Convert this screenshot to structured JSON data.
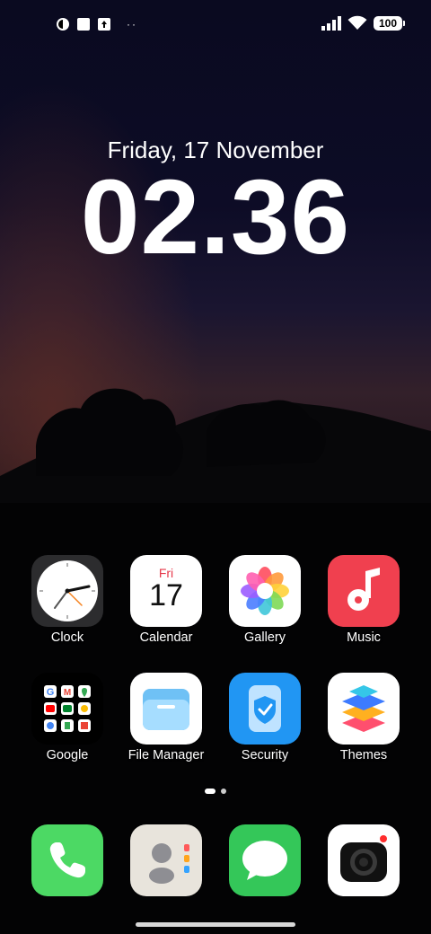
{
  "status_bar": {
    "left_icons": [
      "app-notification-icon",
      "square-notification-icon",
      "upload-notification-icon"
    ],
    "more_dots": "··",
    "right_icons": [
      "signal-icon",
      "wifi-icon"
    ],
    "battery_level": "100"
  },
  "clock_widget": {
    "date": "Friday, 17 November",
    "time": "02.36"
  },
  "apps_row1": [
    {
      "label": "Clock",
      "icon": "clock-icon"
    },
    {
      "label": "Calendar",
      "icon": "calendar-icon",
      "day": "Fri",
      "date": "17"
    },
    {
      "label": "Gallery",
      "icon": "gallery-icon"
    },
    {
      "label": "Music",
      "icon": "music-icon"
    }
  ],
  "apps_row2": [
    {
      "label": "Google",
      "icon": "google-folder-icon"
    },
    {
      "label": "File Manager",
      "icon": "file-manager-icon"
    },
    {
      "label": "Security",
      "icon": "security-icon"
    },
    {
      "label": "Themes",
      "icon": "themes-icon"
    }
  ],
  "page_indicator": {
    "pages": 2,
    "current": 1
  },
  "dock": [
    {
      "icon": "phone-icon"
    },
    {
      "icon": "contacts-icon"
    },
    {
      "icon": "messages-icon"
    },
    {
      "icon": "camera-icon"
    }
  ],
  "colors": {
    "music": "#f0404f",
    "phone": "#4cd964",
    "messages": "#34c759",
    "security": "#2196f3",
    "calendar_accent": "#e6384a"
  }
}
